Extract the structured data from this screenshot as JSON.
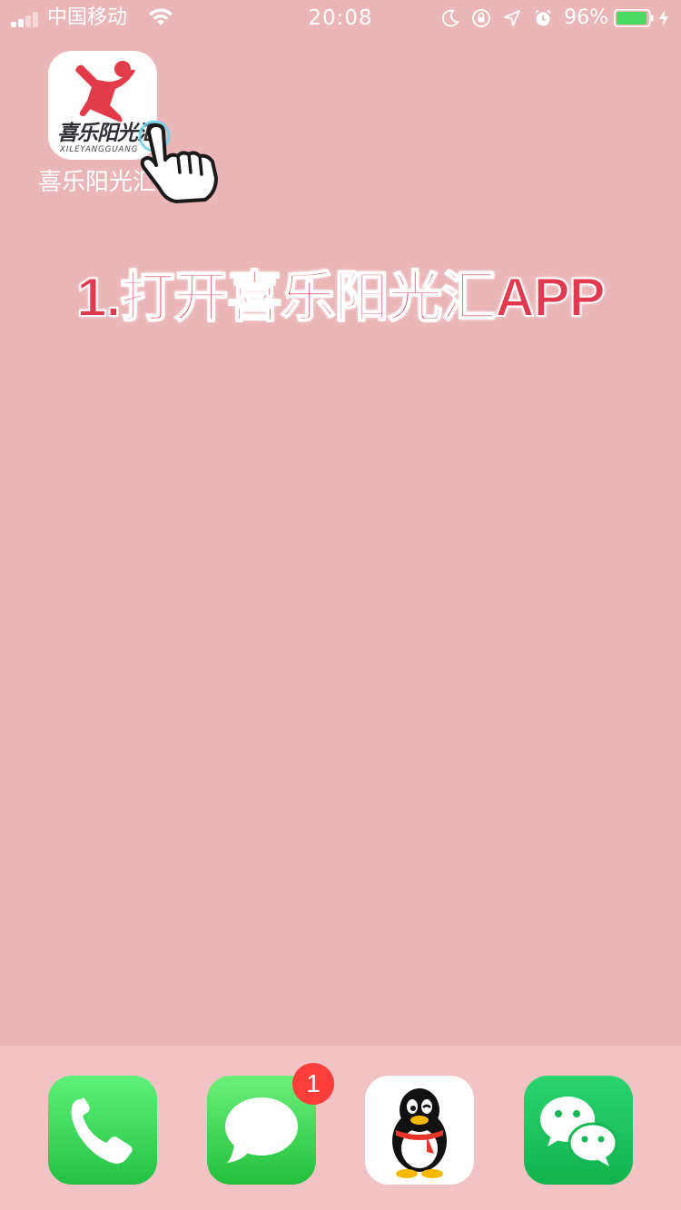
{
  "status_bar": {
    "carrier": "中国移动",
    "time": "20:08",
    "battery_percent": "96%",
    "battery_level": 0.96,
    "icons": [
      "signal-icon",
      "wifi-icon",
      "moon-icon",
      "orientation-lock-icon",
      "location-icon",
      "alarm-icon",
      "battery-icon",
      "charging-icon"
    ]
  },
  "home": {
    "app": {
      "name": "喜乐阳光汇",
      "label": "喜乐阳光汇",
      "icon_text": "喜乐阳光汇",
      "icon_subtext": "XILEYANGGUANG",
      "brand_color": "#e23b4a"
    },
    "instruction": "1.打开喜乐阳光汇APP",
    "instruction_color": "#e13a4f"
  },
  "dock": {
    "apps": [
      {
        "name": "phone",
        "icon": "phone-icon",
        "color": "#34c759"
      },
      {
        "name": "messages",
        "icon": "messages-icon",
        "color": "#34c759",
        "badge": "1"
      },
      {
        "name": "qq",
        "icon": "qq-penguin-icon",
        "color": "#ffffff"
      },
      {
        "name": "wechat",
        "icon": "wechat-icon",
        "color": "#1fbf5f"
      }
    ]
  }
}
